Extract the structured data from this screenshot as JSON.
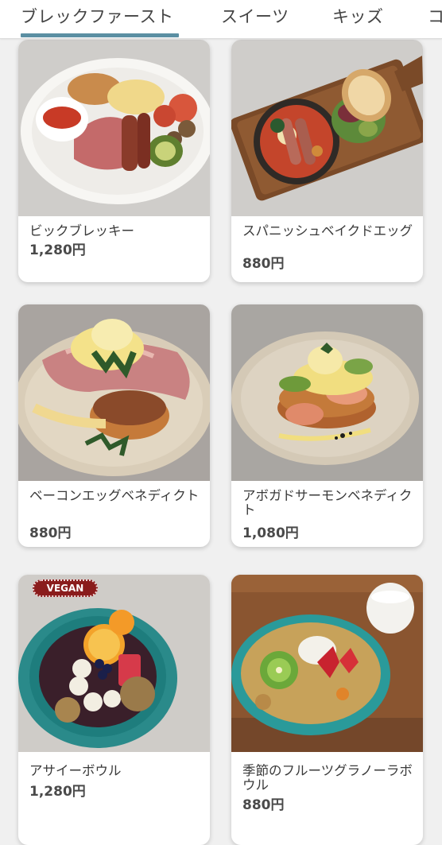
{
  "tabs": [
    {
      "label": "ブレックファースト",
      "selected": true
    },
    {
      "label": "スイーツ",
      "selected": false
    },
    {
      "label": "キッズ",
      "selected": false
    },
    {
      "label": "コ",
      "selected": false
    }
  ],
  "colors": {
    "indicator": "#5b8fa3",
    "badge": "#8a1c1c"
  },
  "items": [
    {
      "name": "ビックブレッキー",
      "price": "1,280円"
    },
    {
      "name": "スパニッシュベイクドエッグ",
      "price": "880円"
    },
    {
      "name": "ベーコンエッグベネディクト",
      "price": "880円"
    },
    {
      "name": "アボガドサーモンベネディクト",
      "price": "1,080円"
    },
    {
      "name": "アサイーボウル",
      "price": "1,280円",
      "badge": "VEGAN"
    },
    {
      "name": "季節のフルーツグラノーラボウル",
      "price": "880円"
    }
  ]
}
